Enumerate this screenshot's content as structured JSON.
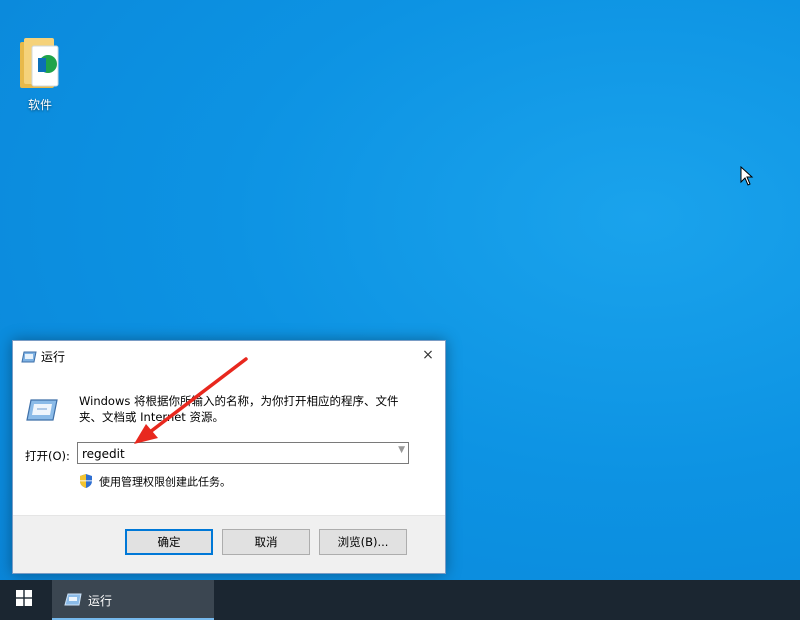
{
  "desktop": {
    "icon_label": "软件"
  },
  "run_dialog": {
    "title": "运行",
    "close_glyph": "×",
    "description": "Windows 将根据你所输入的名称，为你打开相应的程序、文件夹、文档或 Internet 资源。",
    "open_label": "打开(O):",
    "input_value": "regedit",
    "admin_note": "使用管理权限创建此任务。",
    "buttons": {
      "ok": "确定",
      "cancel": "取消",
      "browse": "浏览(B)..."
    }
  },
  "taskbar": {
    "active_item_label": "运行"
  },
  "colors": {
    "desktop": "#0d93e3",
    "accent": "#0078d7",
    "arrow": "#e8281e",
    "taskbar": "#1b2631"
  }
}
